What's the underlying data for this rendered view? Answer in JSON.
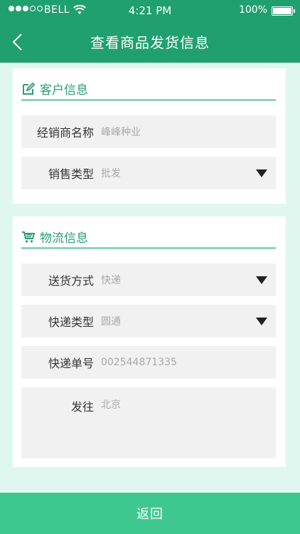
{
  "status_bar": {
    "carrier": "BELL",
    "time": "4:21 PM",
    "battery": "100%"
  },
  "nav": {
    "title": "查看商品发货信息"
  },
  "customer_section": {
    "title": "客户信息",
    "fields": [
      {
        "label": "经销商名称",
        "value": "峰峰种业"
      },
      {
        "label": "销售类型",
        "value": "批发"
      }
    ]
  },
  "logistics_section": {
    "title": "物流信息",
    "fields": [
      {
        "label": "送货方式",
        "value": "快递"
      },
      {
        "label": "快递类型",
        "value": "圆通"
      },
      {
        "label": "快递单号",
        "value": "002544871335"
      },
      {
        "label": "发往",
        "value": "北京"
      }
    ]
  },
  "footer": {
    "button_label": "返回"
  },
  "colors": {
    "header_green": "#20a06f",
    "accent_green": "#2c9c73",
    "footer_green": "#3fc790",
    "background": "#dff7ef"
  }
}
